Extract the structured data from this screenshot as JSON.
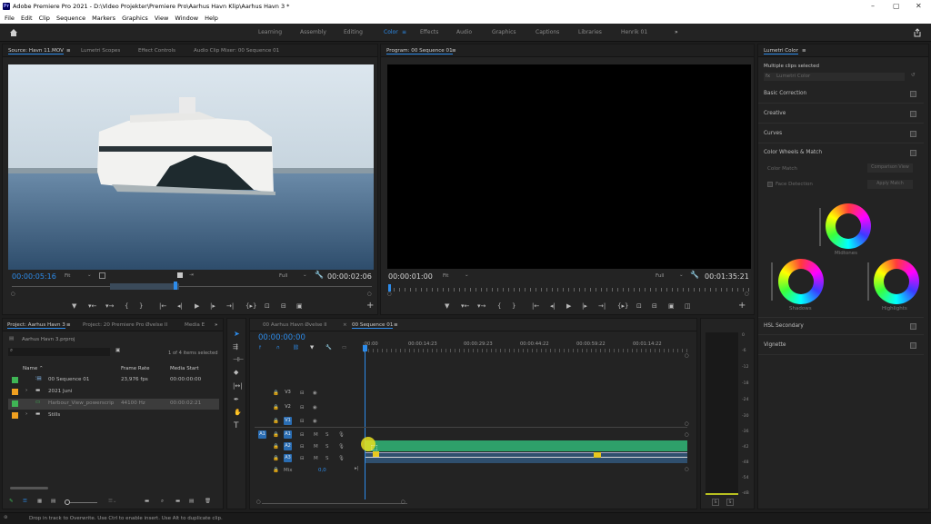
{
  "window": {
    "title": "Adobe Premiere Pro 2021 - D:\\Video Projekter\\Premiere Pro\\Aarhus Havn Klip\\Aarhus Havn 3 *",
    "app_icon_text": "Pr",
    "minimize": "–",
    "maximize": "▢",
    "close": "✕"
  },
  "menu": [
    "File",
    "Edit",
    "Clip",
    "Sequence",
    "Markers",
    "Graphics",
    "View",
    "Window",
    "Help"
  ],
  "workspaces": {
    "items": [
      "Learning",
      "Assembly",
      "Editing",
      "Color",
      "Effects",
      "Audio",
      "Graphics",
      "Captions",
      "Libraries",
      "Henrik 01"
    ],
    "active": "Color",
    "more": "»"
  },
  "source_panel": {
    "tabs": [
      "Source: Havn 11.MOV",
      "Lumetri Scopes",
      "Effect Controls",
      "Audio Clip Mixer: 00 Sequence 01"
    ],
    "timecode": "00:00:05:16",
    "fit": "Fit",
    "quality": "Full",
    "duration": "00:00:02:06"
  },
  "program_panel": {
    "tab": "Program: 00 Sequence 01",
    "timecode": "00:00:01:00",
    "fit": "Fit",
    "quality": "Full",
    "duration": "00:01:35:21"
  },
  "lumetri": {
    "tab": "Lumetri Color",
    "multiple_clips": "Multiple clips selected",
    "clip_select": "Lumetri Color",
    "sections": [
      "Basic Correction",
      "Creative",
      "Curves",
      "Color Wheels & Match"
    ],
    "color_match": "Color Match",
    "comparison_view": "Comparison View",
    "face_detection": "Face Detection",
    "apply_match": "Apply Match",
    "midtones": "Midtones",
    "shadows": "Shadows",
    "highlights": "Highlights",
    "sections_bottom": [
      "HSL Secondary",
      "Vignette"
    ]
  },
  "project_panel": {
    "tabs": [
      "Project: Aarhus Havn 3",
      "Project: 20 Premiere Pro Øvelse II",
      "Media E"
    ],
    "more": "»",
    "file": "Aarhus Havn 3.prproj",
    "items_selected": "1 of 4 items selected",
    "columns": [
      "Name",
      "Frame Rate",
      "Media Start"
    ],
    "rows": [
      {
        "color": "#3fb555",
        "name": "00 Sequence 01",
        "rate": "23,976 fps",
        "start": "00:00:00:00",
        "type": "sequence"
      },
      {
        "color": "#f0a020",
        "name": "2021 Juni",
        "rate": "",
        "start": "",
        "type": "bin"
      },
      {
        "color": "#3fb555",
        "name": "Harbour_View_powerscrip",
        "rate": "44100 Hz",
        "start": "00:00:02:21",
        "type": "audio"
      },
      {
        "color": "#f0a020",
        "name": "Stills",
        "rate": "",
        "start": "",
        "type": "bin"
      }
    ]
  },
  "timeline": {
    "tabs": [
      "00 Aarhus Havn Øvelse II",
      "00 Sequence 01"
    ],
    "timecode": "00:00:00:00",
    "ruler": [
      ":00:00",
      "00:00:14:23",
      "00:00:29:23",
      "00:00:44:22",
      "00:00:59:22",
      "00:01:14:22"
    ],
    "video_tracks": [
      "V3",
      "V2",
      "V1"
    ],
    "audio_tracks": [
      "A1",
      "A2",
      "A3"
    ],
    "source_v": "V1",
    "source_a": "A1",
    "mix_label": "Mix",
    "mix_value": "0,0",
    "mute": "M",
    "solo": "S"
  },
  "meter": {
    "scale": [
      "0",
      "-6",
      "-12",
      "-18",
      "-24",
      "-30",
      "-36",
      "-42",
      "-48",
      "-54",
      "-dB"
    ],
    "solo_left": "S",
    "solo_right": "S"
  },
  "status": {
    "text": "Drop in track to Overwrite. Use Ctrl to enable insert. Use Alt to duplicate clip."
  },
  "colors": {
    "accent": "#2d8ceb",
    "audio_clip": "#2ea06a",
    "label_green": "#3fb555",
    "label_orange": "#f0a020",
    "cursor": "#e8e020"
  }
}
